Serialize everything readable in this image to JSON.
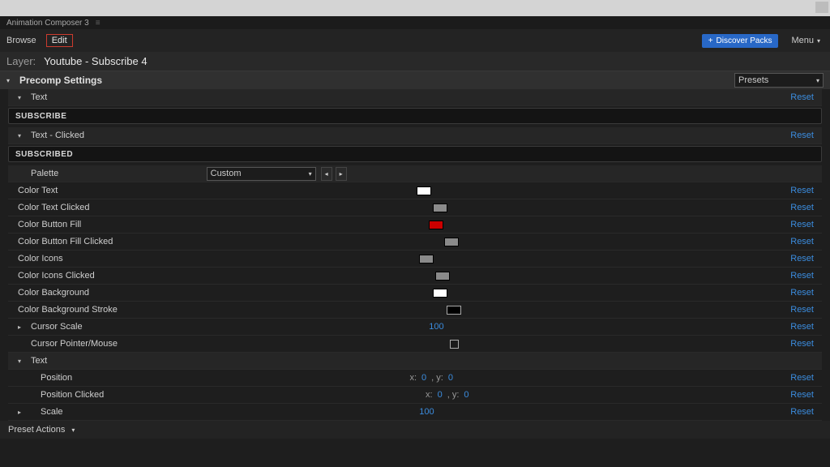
{
  "panel_title": "Animation Composer 3",
  "toolbar": {
    "browse": "Browse",
    "edit": "Edit",
    "discover": "Discover Packs",
    "menu": "Menu"
  },
  "layer": {
    "label": "Layer:",
    "name": "Youtube - Subscribe 4"
  },
  "section": {
    "title": "Precomp Settings",
    "presets_label": "Presets"
  },
  "reset": "Reset",
  "groups": {
    "text": {
      "label": "Text",
      "value": "SUBSCRIBE"
    },
    "text_clicked": {
      "label": "Text - Clicked",
      "value": "SUBSCRIBED"
    },
    "palette": {
      "label": "Palette",
      "value": "Custom"
    }
  },
  "colors": [
    {
      "label": "Color Text",
      "hex": "#ffffff"
    },
    {
      "label": "Color Text Clicked",
      "hex": "#8a8a8a"
    },
    {
      "label": "Color Button Fill",
      "hex": "#cc0000"
    },
    {
      "label": "Color Button Fill Clicked",
      "hex": "#8a8a8a"
    },
    {
      "label": "Color Icons",
      "hex": "#8a8a8a"
    },
    {
      "label": "Color Icons Clicked",
      "hex": "#8a8a8a"
    },
    {
      "label": "Color Background",
      "hex": "#ffffff"
    },
    {
      "label": "Color Background Stroke",
      "hex": "#000000"
    }
  ],
  "cursor_scale": {
    "label": "Cursor Scale",
    "value": "100"
  },
  "cursor_pointer": {
    "label": "Cursor Pointer/Mouse"
  },
  "text_group2": {
    "label": "Text"
  },
  "position": {
    "label": "Position",
    "x_label": "x:",
    "x": "0",
    "y_label": ", y:",
    "y": "0"
  },
  "position_clicked": {
    "label": "Position Clicked",
    "x_label": "x:",
    "x": "0",
    "y_label": ", y:",
    "y": "0"
  },
  "scale": {
    "label": "Scale",
    "value": "100"
  },
  "footer": {
    "preset_actions": "Preset Actions"
  }
}
